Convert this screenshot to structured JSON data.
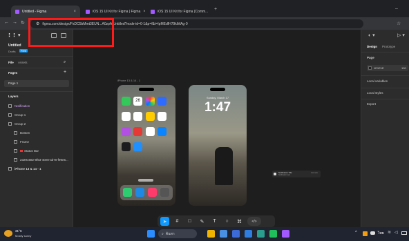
{
  "browser": {
    "tabs": [
      {
        "label": "Untitled - Figma"
      },
      {
        "label": "iOS 15 UI Kit for Figma | Figma"
      },
      {
        "label": "iOS 15 UI Kit for Figma (Comm..."
      }
    ],
    "url": "figma.com/design/FsDC5bMmt3EUN...A0zpA/Untitled?node-id=0-1&p=f&t=IpMEdfH79kiMAg-0",
    "new_tab": "+"
  },
  "figma": {
    "file_name": "Untitled",
    "drafts": "Drafts",
    "plan_badge": "Free",
    "tabs": {
      "file": "File",
      "assets": "Assets"
    },
    "pages_label": "Pages",
    "page_item": "Page 1",
    "layers_label": "Layers",
    "layers": [
      "Notification",
      "Group 1",
      "Group 2",
      "Bottom",
      "Frame",
      "Status Bar",
      "23291582-8f53-40e8-ab70-f99e5...",
      "iPhone 13 & 14 - 1"
    ],
    "right": {
      "design_tab": "Design",
      "prototype_tab": "Prototype",
      "page_label": "Page",
      "page_color": "1E1E1E",
      "page_opacity": "100",
      "local_variables": "Local variables",
      "local_styles": "Local styles",
      "export": "Export"
    },
    "canvas": {
      "frame_label": "iPhone 13 & 14 - 1",
      "lock_date": "Sunday, March 17",
      "lock_time": "1:47",
      "calendar_day": "26",
      "notification_title": "Notification Title",
      "notification_body": "Notification text",
      "notification_time": "Just now"
    },
    "toolbar_icons": [
      "move-tool",
      "frame-tool",
      "shape-tool",
      "pen-tool",
      "text-tool",
      "comment-tool",
      "actions-tool",
      "dev-mode-toggle"
    ]
  },
  "taskbar": {
    "weather_temp": "31°C",
    "weather_text": "Mostly sunny",
    "search_placeholder": "ค้นหา",
    "lang": "ไทย"
  },
  "colors": {
    "figma_accent": "#0d99ff",
    "annotation": "#ff1a1a"
  }
}
